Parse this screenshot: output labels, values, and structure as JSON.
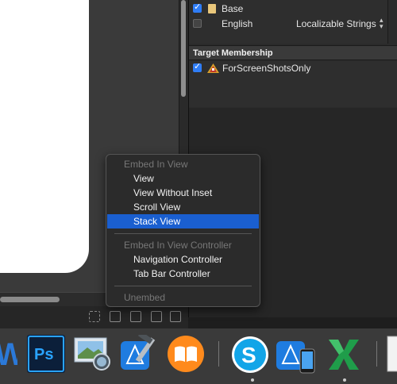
{
  "inspector": {
    "localization": [
      {
        "checked": true,
        "label": "Base",
        "type": ""
      },
      {
        "checked": false,
        "label": "English",
        "type": "Localizable Strings"
      }
    ],
    "target_membership_header": "Target Membership",
    "targets": [
      {
        "checked": true,
        "label": "ForScreenShotsOnly"
      }
    ]
  },
  "context_menu": {
    "embed_in_view_header": "Embed In View",
    "items_view": [
      "View",
      "View Without Inset",
      "Scroll View",
      "Stack View"
    ],
    "selected": "Stack View",
    "embed_in_controller_header": "Embed In View Controller",
    "items_controller": [
      "Navigation Controller",
      "Tab Bar Controller"
    ],
    "unembed": "Unembed"
  },
  "dock": {
    "apps": [
      "word-icon",
      "photoshop-icon",
      "preview-icon",
      "xcode-icon",
      "ibooks-icon",
      "skype-icon",
      "simulator-icon",
      "excel-icon"
    ]
  }
}
